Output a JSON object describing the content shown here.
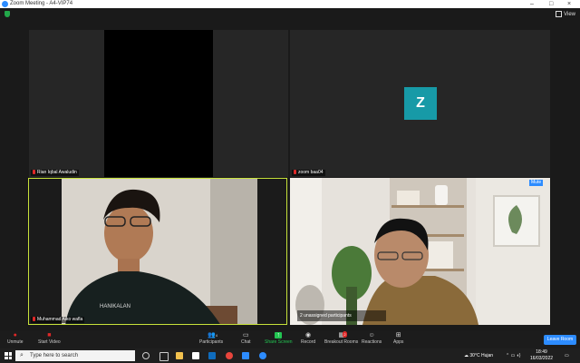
{
  "window": {
    "title": "Zoom Meeting - A4-VIP74",
    "minimize": "–",
    "maximize": "□",
    "close": "×"
  },
  "topbar": {
    "view_label": "View"
  },
  "tiles": [
    {
      "name": "Rian Iqbal Awaludin"
    },
    {
      "name": "zoom baa04",
      "avatar_letter": "Z"
    },
    {
      "name": "Muhammad Aiko wafla"
    },
    {
      "name": "",
      "mute_label": "Mute"
    }
  ],
  "overlay": {
    "text": "2 unassigned participants"
  },
  "toolbar": {
    "unmute": "Unmute",
    "start_video": "Start Video",
    "participants": "Participants",
    "participants_count": "4",
    "chat": "Chat",
    "share_screen": "Share Screen",
    "record": "Record",
    "breakout_rooms": "Breakout Rooms",
    "breakout_badge": "2",
    "reactions": "Reactions",
    "apps": "Apps",
    "leave_room": "Leave Room"
  },
  "taskbar": {
    "search_placeholder": "Type here to search",
    "weather": "30°C  Hujan",
    "time": "18:49",
    "date": "16/03/2022"
  },
  "colors": {
    "accent": "#2d8cff",
    "share": "#23c552",
    "avatar": "#179aa7",
    "active_border": "#c7e23a"
  }
}
